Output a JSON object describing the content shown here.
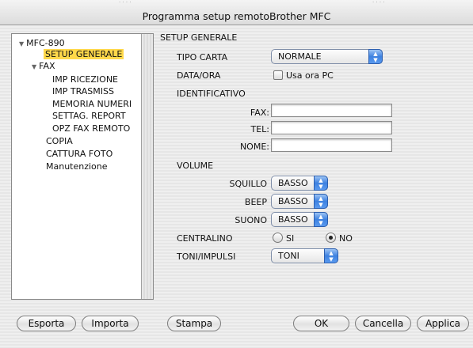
{
  "window": {
    "title": "Programma setup remotoBrother MFC",
    "ghost_title_left": "· · · ·",
    "ghost_title_right": "· · · ·"
  },
  "tree": {
    "items": [
      {
        "label": "MFC-890",
        "expanded": true
      },
      {
        "label": "SETUP GENERALE",
        "selected": true
      },
      {
        "label": "FAX",
        "expanded": true
      },
      {
        "label": "IMP RICEZIONE"
      },
      {
        "label": "IMP TRASMISS"
      },
      {
        "label": "MEMORIA NUMERI"
      },
      {
        "label": "SETTAG. REPORT"
      },
      {
        "label": "OPZ FAX REMOTO"
      },
      {
        "label": "COPIA"
      },
      {
        "label": "CATTURA FOTO"
      },
      {
        "label": "Manutenzione"
      }
    ]
  },
  "section": {
    "title": "SETUP GENERALE"
  },
  "tipo_carta": {
    "label": "TIPO CARTA",
    "value": "NORMALE"
  },
  "data_ora": {
    "label": "DATA/ORA",
    "checkbox_label": "Usa ora PC",
    "checked": false
  },
  "identificativo": {
    "label": "IDENTIFICATIVO",
    "fax_label": "FAX:",
    "fax_value": "",
    "tel_label": "TEL:",
    "tel_value": "",
    "nome_label": "NOME:",
    "nome_value": ""
  },
  "volume": {
    "label": "VOLUME",
    "squillo_label": "SQUILLO",
    "squillo_value": "BASSO",
    "beep_label": "BEEP",
    "beep_value": "BASSO",
    "suono_label": "SUONO",
    "suono_value": "BASSO"
  },
  "centralino": {
    "label": "CENTRALINO",
    "opt_si": "SI",
    "opt_no": "NO",
    "selected": "NO"
  },
  "toni_impulsi": {
    "label": "TONI/IMPULSI",
    "value": "TONI"
  },
  "buttons": {
    "esporta": "Esporta",
    "importa": "Importa",
    "stampa": "Stampa",
    "ok": "OK",
    "cancella": "Cancella",
    "applica": "Applica"
  },
  "icons": {
    "popup_arrows": "updown-arrows-icon",
    "tree_expanded": "disclosure-triangle-down-icon"
  },
  "colors": {
    "selection": "#ffd84a",
    "popup_accent": "#3d81e0"
  }
}
